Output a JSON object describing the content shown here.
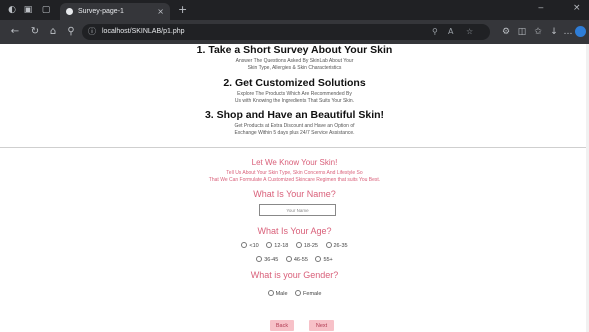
{
  "browser": {
    "tab_title": "Survey-page-1",
    "url": "localhost/SKINLAB/p1.php",
    "new_tab_glyph": "+",
    "minimize_glyph": "‒",
    "close_glyph": "×"
  },
  "sections": [
    {
      "title": "1. Take a Short Survey About Your Skin",
      "desc_line1": "Answer The Questions Asked By SkinLab About Your",
      "desc_line2": "Skin Type, Allergies & Skin Characteristics"
    },
    {
      "title": "2. Get Customized Solutions",
      "desc_line1": "Explore The Products Which Are Recommended By",
      "desc_line2": "Us with Knowing the Ingredients That Suits Your Skin."
    },
    {
      "title": "3. Shop and Have an Beautiful Skin!",
      "desc_line1": "Get Products at Extra Discount and Have an Option of",
      "desc_line2": "Exchange Within 5 days plus 24/7 Service Assistance."
    }
  ],
  "survey": {
    "intro_title": "Let We Know Your Skin!",
    "intro_line1": "Tell Us About Your Skin Type, Skin Concerns And Lifestyle So",
    "intro_line2": "That We Can Formulate A Customized Skincare Regimen that suits You Best.",
    "name_question": "What Is Your Name?",
    "name_placeholder": "Your Name",
    "age_question": "What Is Your Age?",
    "age_options_row1": [
      "<10",
      "12-18",
      "18-25",
      "26-35"
    ],
    "age_options_row2": [
      "36-45",
      "46-55",
      "55+"
    ],
    "gender_question": "What is your Gender?",
    "gender_options": [
      "Male",
      "Female"
    ],
    "back_label": "Back",
    "next_label": "Next"
  },
  "colors": {
    "accent": "#d9607a",
    "button_bg": "#f7c1c8",
    "chrome_dark": "#202124",
    "chrome_toolbar": "#35363a"
  }
}
